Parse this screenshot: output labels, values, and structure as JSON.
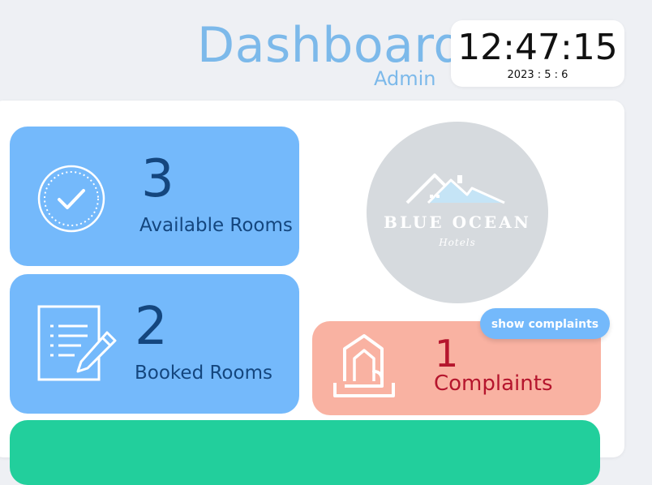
{
  "header": {
    "title": "Dashboard",
    "subtitle": "Admin"
  },
  "clock": {
    "time": "12:47:15",
    "date": "2023 : 5 : 6"
  },
  "cards": {
    "available": {
      "count": "3",
      "label": "Available Rooms",
      "icon": "checkmark-circle-icon"
    },
    "booked": {
      "count": "2",
      "label": "Booked Rooms",
      "icon": "document-pencil-icon"
    },
    "complaints": {
      "count": "1",
      "label": "Complaints",
      "icon": "building-hand-icon"
    }
  },
  "logo": {
    "name": "BLUE OCEAN",
    "subtitle": "Hotels"
  },
  "buttons": {
    "show_complaints": "show complaints"
  },
  "colors": {
    "accent_blue": "#74b9fb",
    "title_blue": "#7cb9ea",
    "card_text": "#14467e",
    "complaints_bg": "#f9b2a2",
    "complaints_text": "#b5152d",
    "green_card": "#22cf9c"
  }
}
